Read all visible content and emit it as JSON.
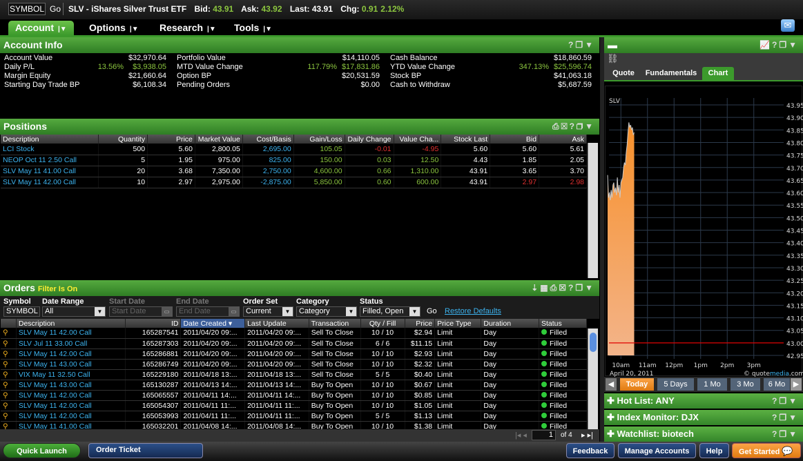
{
  "topbar": {
    "symbol_placeholder": "SYMBOL",
    "go": "Go",
    "title": "SLV - iShares Silver Trust ETF",
    "bid_label": "Bid:",
    "bid": "43.91",
    "ask_label": "Ask:",
    "ask": "43.92",
    "last_label": "Last:",
    "last": "43.91",
    "chg_label": "Chg:",
    "chg": "0.91",
    "chg_pct": "2.12%"
  },
  "nav": {
    "tabs": [
      "Account",
      "Options",
      "Research",
      "Tools"
    ],
    "active": "Account"
  },
  "account_info": {
    "title": "Account Info",
    "rows": [
      [
        [
          "Account Value",
          "",
          "$32,970.64"
        ],
        [
          "Portfolio Value",
          "",
          "$14,110.05"
        ],
        [
          "Cash Balance",
          "",
          "$18,860.59"
        ]
      ],
      [
        [
          "Daily P/L",
          "13.56%",
          "$3,938.05"
        ],
        [
          "MTD Value Change",
          "117.79%",
          "$17,831.86"
        ],
        [
          "YTD Value Change",
          "347.13%",
          "$25,596.74"
        ]
      ],
      [
        [
          "Margin Equity",
          "",
          "$21,660.64"
        ],
        [
          "Option BP",
          "",
          "$20,531.59"
        ],
        [
          "Stock BP",
          "",
          "$41,063.18"
        ]
      ],
      [
        [
          "Starting Day Trade BP",
          "",
          "$6,108.34"
        ],
        [
          "Pending Orders",
          "",
          "$0.00"
        ],
        [
          "Cash to Withdraw",
          "",
          "$5,687.59"
        ]
      ]
    ]
  },
  "positions": {
    "title": "Positions",
    "columns": [
      "Description",
      "Quantity",
      "Price",
      "Market Value",
      "Cost/Basis",
      "Gain/Loss",
      "Daily Change",
      "Value Cha...",
      "Stock Last",
      "Bid",
      "Ask"
    ],
    "rows": [
      [
        "LCI Stock",
        "500",
        "5.60",
        "2,800.05",
        "2,695.00",
        "105.05",
        "-0.01",
        "-4.95",
        "5.60",
        "5.60",
        "5.61"
      ],
      [
        "NEOP Oct 11 2.50 Call",
        "5",
        "1.95",
        "975.00",
        "825.00",
        "150.00",
        "0.03",
        "12.50",
        "4.43",
        "1.85",
        "2.05"
      ],
      [
        "SLV May 11 41.00 Call",
        "20",
        "3.68",
        "7,350.00",
        "2,750.00",
        "4,600.00",
        "0.66",
        "1,310.00",
        "43.91",
        "3.65",
        "3.70"
      ],
      [
        "SLV May 11 42.00 Call",
        "10",
        "2.97",
        "2,975.00",
        "-2,875.00",
        "5,850.00",
        "0.60",
        "600.00",
        "43.91",
        "2.97",
        "2.98"
      ]
    ]
  },
  "orders": {
    "title": "Orders",
    "filter_note": "Filter Is On",
    "filters": {
      "symbol_label": "Symbol",
      "symbol": "SYMBOL",
      "date_range_label": "Date Range",
      "date_range": "All",
      "start_label": "Start Date",
      "start_placeholder": "Start Date",
      "end_label": "End Date",
      "end_placeholder": "End Date",
      "order_set_label": "Order Set",
      "order_set": "Current",
      "category_label": "Category",
      "category": "Category",
      "status_label": "Status",
      "status": "Filled, Open",
      "go": "Go",
      "restore": "Restore Defaults"
    },
    "columns": [
      "Description",
      "ID",
      "Date Created ▾",
      "Last Update",
      "Transaction",
      "Qty / Fill",
      "Price",
      "Price Type",
      "Duration",
      "Status"
    ],
    "rows": [
      [
        "SLV May 11 42.00 Call",
        "165287541",
        "2011/04/20 09:...",
        "2011/04/20 09:...",
        "Sell To Close",
        "10 / 10",
        "$2.94",
        "Limit",
        "Day",
        "Filled"
      ],
      [
        "SLV Jul 11 33.00 Call",
        "165287303",
        "2011/04/20 09:...",
        "2011/04/20 09:...",
        "Sell To Close",
        "6 / 6",
        "$11.15",
        "Limit",
        "Day",
        "Filled"
      ],
      [
        "SLV May 11 42.00 Call",
        "165286881",
        "2011/04/20 09:...",
        "2011/04/20 09:...",
        "Sell To Close",
        "10 / 10",
        "$2.93",
        "Limit",
        "Day",
        "Filled"
      ],
      [
        "SLV May 11 43.00 Call",
        "165286749",
        "2011/04/20 09:...",
        "2011/04/20 09:...",
        "Sell To Close",
        "10 / 10",
        "$2.32",
        "Limit",
        "Day",
        "Filled"
      ],
      [
        "VIX May 11 32.50 Call",
        "165229180",
        "2011/04/18 13:...",
        "2011/04/18 13:...",
        "Sell To Close",
        "5 / 5",
        "$0.40",
        "Limit",
        "Day",
        "Filled"
      ],
      [
        "SLV May 11 43.00 Call",
        "165130287",
        "2011/04/13 14:...",
        "2011/04/13 14:...",
        "Buy To Open",
        "10 / 10",
        "$0.67",
        "Limit",
        "Day",
        "Filled"
      ],
      [
        "SLV May 11 42.00 Call",
        "165065557",
        "2011/04/11 14:...",
        "2011/04/11 14:...",
        "Buy To Open",
        "10 / 10",
        "$0.85",
        "Limit",
        "Day",
        "Filled"
      ],
      [
        "SLV May 11 42.00 Call",
        "165054307",
        "2011/04/11 11:...",
        "2011/04/11 11:...",
        "Buy To Open",
        "10 / 10",
        "$1.05",
        "Limit",
        "Day",
        "Filled"
      ],
      [
        "SLV May 11 42.00 Call",
        "165053993",
        "2011/04/11 11:...",
        "2011/04/11 11:...",
        "Buy To Open",
        "5 / 5",
        "$1.13",
        "Limit",
        "Day",
        "Filled"
      ],
      [
        "SLV May 11 41.00 Call",
        "165032201",
        "2011/04/08 14:...",
        "2011/04/08 14:...",
        "Buy To Open",
        "10 / 10",
        "$1.38",
        "Limit",
        "Day",
        "Filled"
      ]
    ],
    "page": "1",
    "page_of": "of 4"
  },
  "right": {
    "tabs": [
      "Quote",
      "Fundamentals",
      "Chart"
    ],
    "active_tab": "Chart",
    "ranges": [
      "Today",
      "5 Days",
      "1 Mo",
      "3 Mo",
      "6 Mo"
    ],
    "active_range": "Today",
    "widgets": [
      "Hot List: ANY",
      "Index Monitor: DJX",
      "Watchlist: biotech"
    ]
  },
  "chart_data": {
    "type": "area",
    "title": "SLV",
    "date": "April 20, 2011",
    "credit_a": "© quote",
    "credit_b": "media",
    "credit_c": ".com",
    "ylim": [
      42.95,
      43.95
    ],
    "yticks": [
      "43.95",
      "43.90",
      "43.85",
      "43.80",
      "43.75",
      "43.70",
      "43.65",
      "43.60",
      "43.55",
      "43.50",
      "43.45",
      "43.40",
      "43.35",
      "43.30",
      "43.25",
      "43.20",
      "43.15",
      "43.10",
      "43.05",
      "43.00",
      "42.95"
    ],
    "xticks": [
      "10am",
      "11am",
      "12pm",
      "1pm",
      "2pm",
      "3pm"
    ],
    "reference_line": 43.0,
    "reference_color": "#e00000",
    "fill_color": "#f7902a",
    "grid": true,
    "x": [
      "9:30",
      "9:32",
      "9:34",
      "9:36",
      "9:38",
      "9:40",
      "9:42",
      "9:44",
      "9:46",
      "9:48",
      "9:50",
      "9:52",
      "9:54",
      "9:56",
      "9:58",
      "10:00",
      "10:02",
      "10:04",
      "10:06",
      "10:08",
      "10:10",
      "10:12",
      "10:14",
      "10:16",
      "10:18",
      "10:20",
      "10:22",
      "10:24",
      "10:26",
      "10:28",
      "10:30"
    ],
    "y": [
      43.67,
      43.58,
      43.6,
      43.57,
      43.61,
      43.58,
      43.63,
      43.64,
      43.6,
      43.62,
      43.59,
      43.66,
      43.6,
      43.63,
      43.58,
      43.64,
      43.65,
      43.66,
      43.7,
      43.72,
      43.71,
      43.76,
      43.79,
      43.84,
      43.88,
      43.86,
      43.87,
      43.85,
      43.86,
      43.83,
      43.84
    ]
  },
  "bottom": {
    "quick_launch": "Quick Launch",
    "order_ticket": "Order Ticket",
    "feedback": "Feedback",
    "manage": "Manage Accounts",
    "help": "Help",
    "get_started": "Get Started"
  },
  "colors": {
    "accent_green": "#3c9a2c",
    "gain": "#8cc63f",
    "loss": "#e03030",
    "link": "#3db4f0",
    "orange": "#f7902a"
  }
}
